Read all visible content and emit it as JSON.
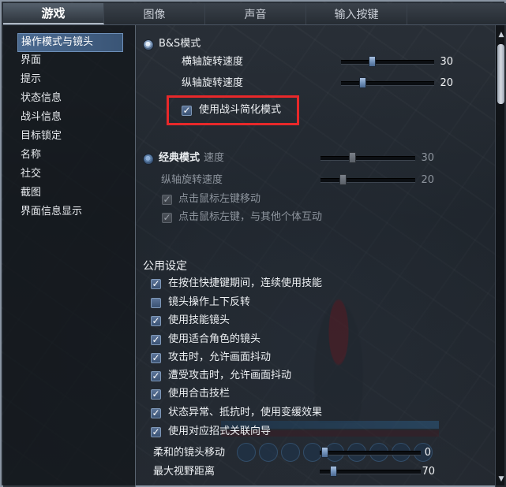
{
  "tabs": [
    "游戏",
    "图像",
    "声音",
    "输入按键"
  ],
  "sidebar": {
    "items": [
      "操作模式与镜头",
      "界面",
      "提示",
      "状态信息",
      "战斗信息",
      "目标锁定",
      "名称",
      "社交",
      "截图",
      "界面信息显示"
    ],
    "selected": "操作模式与镜头"
  },
  "bs_mode": {
    "label": "B&S模式",
    "selected": true,
    "horizontal_label": "横轴旋转速度",
    "horizontal_value": "30",
    "vertical_label": "纵轴旋转速度",
    "vertical_value": "20",
    "simplified_label": "使用战斗简化模式",
    "simplified_checked": true
  },
  "classic_mode": {
    "label": "经典模式",
    "selected": false,
    "horizontal_label_partial": "速度",
    "horizontal_value": "30",
    "vertical_label": "纵轴旋转速度",
    "vertical_value": "20",
    "option1": "点击鼠标左键移动",
    "option2": "点击鼠标左键，与其他个体互动"
  },
  "common": {
    "title": "公用设定",
    "options": [
      {
        "label": "在按住快捷键期间，连续使用技能",
        "checked": true
      },
      {
        "label": "镜头操作上下反转",
        "checked": false
      },
      {
        "label": "使用技能镜头",
        "checked": true
      },
      {
        "label": "使用适合角色的镜头",
        "checked": true
      },
      {
        "label": "攻击时，允许画面抖动",
        "checked": true
      },
      {
        "label": "遭受攻击时，允许画面抖动",
        "checked": true
      },
      {
        "label": "使用合击技栏",
        "checked": true
      },
      {
        "label": "状态异常、抵抗时，使用变缓效果",
        "checked": true
      },
      {
        "label": "使用对应招式关联向导",
        "checked": true
      }
    ],
    "soft_camera_label": "柔和的镜头移动",
    "soft_camera_value": "0",
    "max_view_label": "最大视野距离",
    "max_view_value": "70"
  },
  "checkmark": "✓",
  "colors": {
    "highlight": "#e8282a",
    "accent": "#4b6a90"
  }
}
